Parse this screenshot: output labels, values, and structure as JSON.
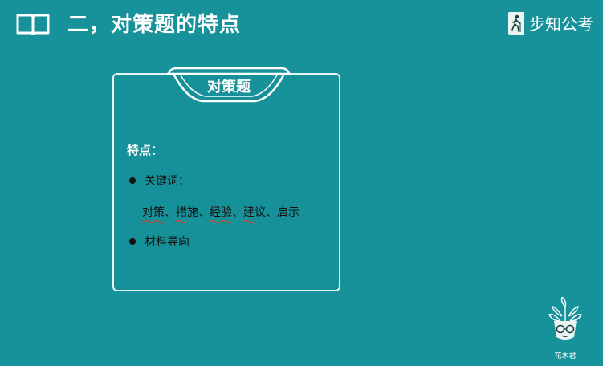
{
  "header": {
    "title": "二，对策题的特点",
    "book_icon": "open-book-icon",
    "brand_name": "步知公考",
    "brand_logo_icon": "hiker-logo-icon"
  },
  "card": {
    "tab_label": "对策题",
    "features_heading": "特点：",
    "bullets": [
      {
        "label": "关键词："
      },
      {
        "label": "材料导向"
      }
    ],
    "keywords": {
      "k1": "对策",
      "sep1": "、",
      "k2": "措施",
      "sep2": "、",
      "k3": "经验",
      "sep3": "、",
      "k4": "建议",
      "sep4": "、",
      "k5": "启示"
    }
  },
  "mascot": {
    "icon": "flower-mascot-icon",
    "caption": "花木君"
  },
  "colors": {
    "background": "#17929a",
    "card_border": "#e6f4f4",
    "text_white": "#ffffff",
    "text_dark": "#111111",
    "squiggle_underline": "#d9431f"
  }
}
